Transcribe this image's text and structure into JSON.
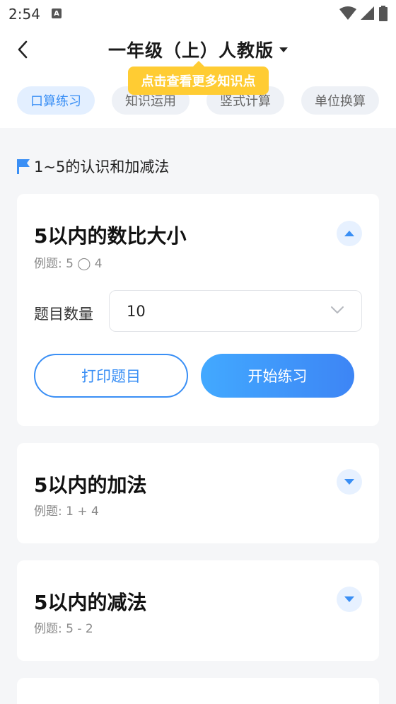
{
  "status_bar": {
    "time": "2:54",
    "notif_letter": "A"
  },
  "header": {
    "title": "一年级（上）人教版",
    "tooltip": "点击查看更多知识点"
  },
  "tabs": [
    {
      "label": "口算练习",
      "active": true
    },
    {
      "label": "知识运用",
      "active": false
    },
    {
      "label": "竖式计算",
      "active": false
    },
    {
      "label": "单位换算",
      "active": false
    }
  ],
  "section": {
    "title": "1~5的认识和加减法"
  },
  "cards": [
    {
      "title": "5以内的数比大小",
      "example": "例题: 5 ◯ 4",
      "expanded": true,
      "count_label": "题目数量",
      "count_value": "10",
      "print_label": "打印题目",
      "start_label": "开始练习"
    },
    {
      "title": "5以内的加法",
      "example": "例题: 1 + 4",
      "expanded": false
    },
    {
      "title": "5以内的减法",
      "example": "例题: 5 - 2",
      "expanded": false
    }
  ],
  "colors": {
    "accent": "#3a8ff5",
    "tooltip": "#ffcc33",
    "tab_bg": "#eef1f6",
    "page_bg": "#f5f6f8"
  }
}
